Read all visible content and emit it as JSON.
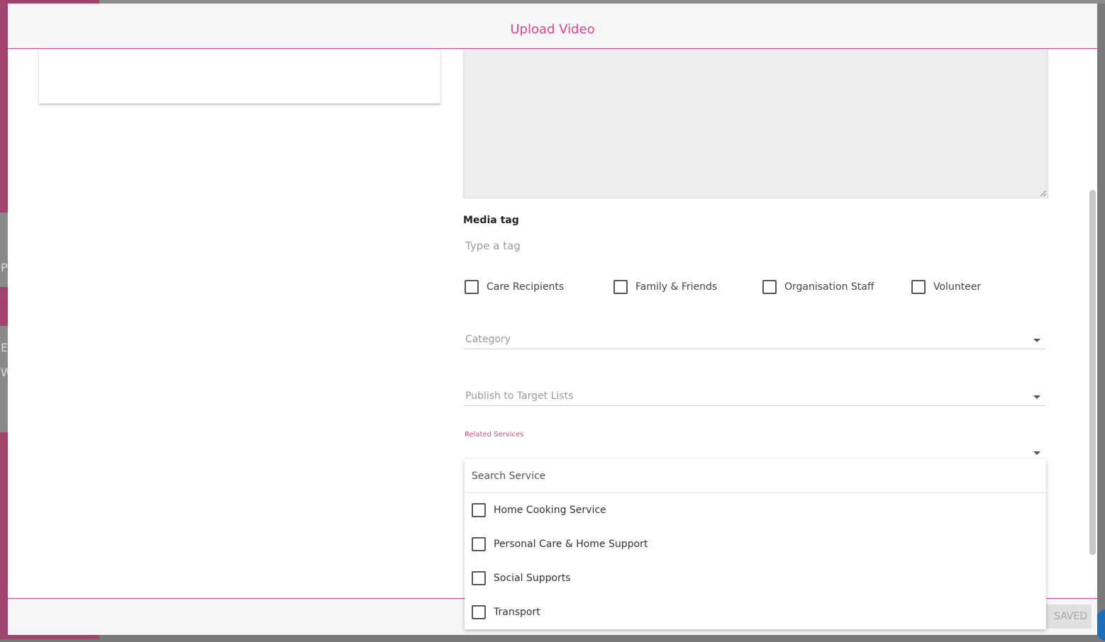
{
  "background": {
    "letters": [
      "P",
      "S",
      "E",
      "W"
    ]
  },
  "modal": {
    "title": "Upload Video"
  },
  "media_tag": {
    "label": "Media tag",
    "placeholder": "Type a tag"
  },
  "audience": [
    {
      "label": "Care Recipients",
      "checked": false
    },
    {
      "label": "Family & Friends",
      "checked": false
    },
    {
      "label": "Organisation Staff",
      "checked": false
    },
    {
      "label": "Volunteer",
      "checked": false
    }
  ],
  "category": {
    "label": "Category"
  },
  "target_lists": {
    "label": "Publish to Target Lists"
  },
  "related_services": {
    "label": "Related Services",
    "search_placeholder": "Search Service",
    "options": [
      {
        "label": "Home Cooking Service",
        "checked": false
      },
      {
        "label": "Personal Care & Home Support",
        "checked": false
      },
      {
        "label": "Social Supports",
        "checked": false
      },
      {
        "label": "Transport",
        "checked": false
      }
    ]
  },
  "footer": {
    "saved_label": "SAVED"
  },
  "colors": {
    "accent": "#e4448b",
    "header_bg": "#f6f6f8",
    "textarea_bg": "#ededed"
  }
}
